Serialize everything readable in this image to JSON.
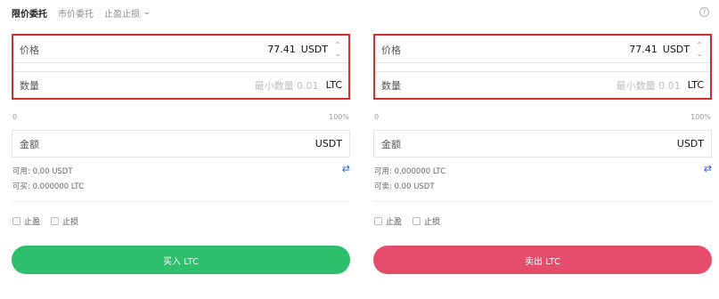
{
  "tabs": [
    {
      "label": "限价委托",
      "active": true
    },
    {
      "label": "市价委托",
      "active": false
    },
    {
      "label": "止盈止损",
      "active": false
    }
  ],
  "colors": {
    "buy": "#2dbf6b",
    "sell": "#e54c6b",
    "highlight": "#d32f2f",
    "swap_icon": "#2a59d6"
  },
  "buy": {
    "price_label": "价格",
    "price_value": "77.41",
    "price_unit": "USDT",
    "qty_label": "数量",
    "qty_placeholder": "最小数量 0.01",
    "qty_unit": "LTC",
    "range_min": "0",
    "range_max": "100%",
    "amount_label": "金额",
    "amount_unit": "USDT",
    "available": "可用: 0.00 USDT",
    "can_trade": "可买: 0.000000 LTC",
    "take_profit": "止盈",
    "stop_loss": "止损",
    "button": "买入 LTC"
  },
  "sell": {
    "price_label": "价格",
    "price_value": "77.41",
    "price_unit": "USDT",
    "qty_label": "数量",
    "qty_placeholder": "最小数量 0.01",
    "qty_unit": "LTC",
    "range_min": "0",
    "range_max": "100%",
    "amount_label": "金额",
    "amount_unit": "USDT",
    "available": "可用: 0.000000 LTC",
    "can_trade": "可卖: 0.00 USDT",
    "take_profit": "止盈",
    "stop_loss": "止损",
    "button": "卖出 LTC"
  }
}
